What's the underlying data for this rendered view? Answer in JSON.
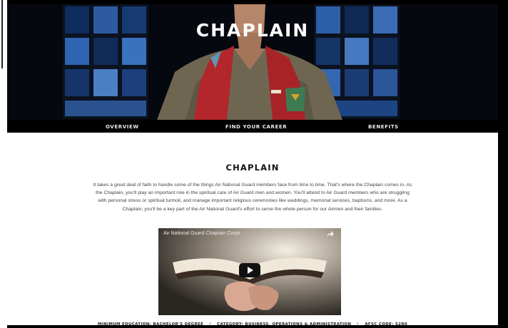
{
  "hero": {
    "title": "CHAPLAIN"
  },
  "nav": {
    "items": [
      {
        "label": "OVERVIEW"
      },
      {
        "label": "FIND YOUR CAREER"
      },
      {
        "label": "BENEFITS"
      }
    ]
  },
  "main": {
    "title": "CHAPLAIN",
    "intro": "It takes a great deal of faith to handle some of the things Air National Guard members face from time to time. That's where the Chaplain comes in. As the Chaplain, you'll play an important role in the spiritual care of Air Guard men and women. You'll attend to Air Guard members who are struggling with personal stress or spiritual turmoil, and manage important religious ceremonies like weddings, memorial services, baptisms, and more. As a Chaplain, you'll be a key part of the Air National Guard's effort to serve the whole person for our Airmen and their families."
  },
  "video": {
    "title": "Air National Guard Chaplain Corps",
    "share_icon": "share-arrow-icon",
    "play_icon": "play-icon"
  },
  "info_bar": {
    "education": "MINIMUM EDUCATION: BACHELOR'S DEGREE",
    "category": "CATEGORY: BUSINESS, OPERATIONS & ADMINISTRATION",
    "afsc": "AFSC CODE: 52R0",
    "separator": "|"
  },
  "colors": {
    "hero_background": "#06080f",
    "stained_glass_blue": "#1d3f7a",
    "stole_red": "#b3262b",
    "nav_background": "#000000",
    "title_text": "#111111"
  }
}
